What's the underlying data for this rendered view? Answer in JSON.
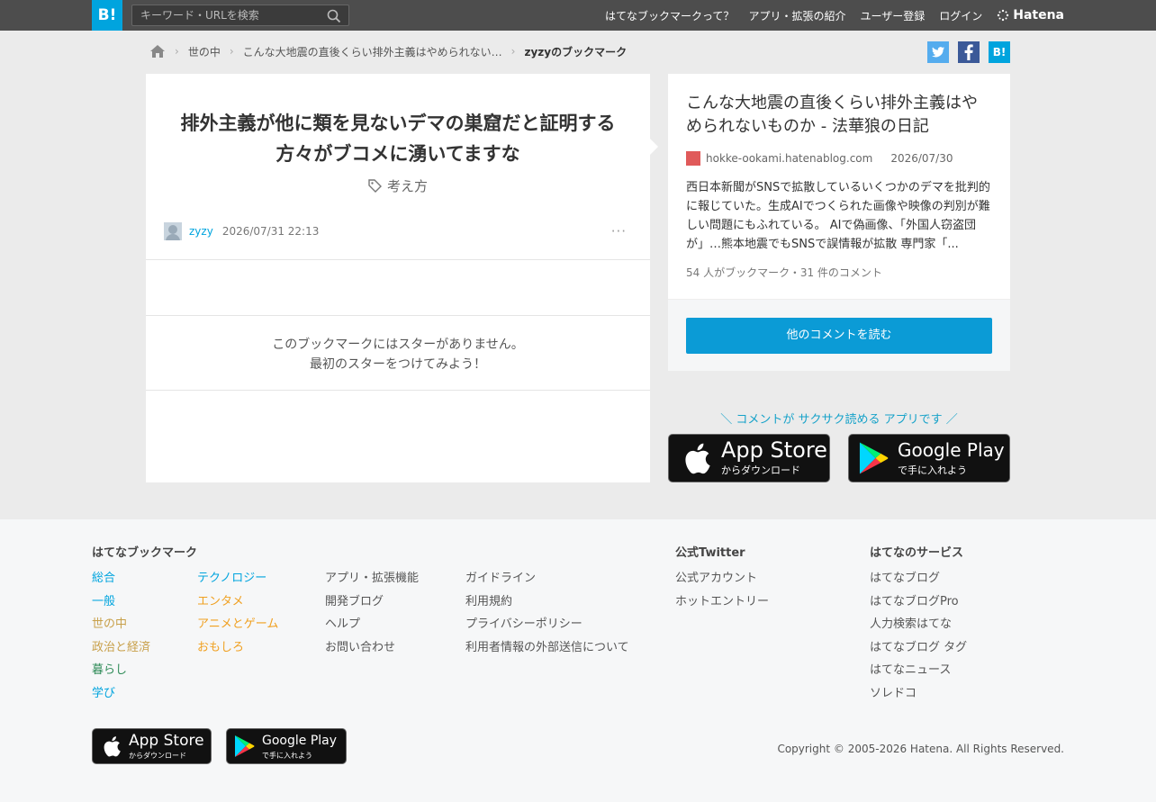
{
  "header": {
    "logo": "B!",
    "search_placeholder": "キーワード・URLを検索",
    "nav": [
      "はてなブックマークって？",
      "アプリ・拡張の紹介",
      "ユーザー登録",
      "ログイン"
    ],
    "hatena": "Hatena"
  },
  "breadcrumb": {
    "items": [
      "世の中",
      "こんな大地震の直後くらい排外主義はやめられない…"
    ],
    "current": "zyzyのブックマーク"
  },
  "share": {
    "hatena": "B!"
  },
  "bookmark": {
    "comment": "排外主義が他に類を見ないデマの巣窟だと証明する方々がブコメに湧いてますな",
    "tag": "考え方",
    "user": "zyzy",
    "date": "2026/07/31 22:13",
    "more": "···",
    "no_star_line1": "このブックマークにはスターがありません。",
    "no_star_line2": "最初のスターをつけてみよう！"
  },
  "entry": {
    "title": "こんな大地震の直後くらい排外主義はやめられないものか - 法華狼の日記",
    "domain": "hokke-ookami.hatenablog.com",
    "date": "2026/07/30",
    "description": "西日本新聞がSNSで拡散しているいくつかのデマを批判的に報じていた。生成AIでつくられた画像や映像の判別が難しい問題にもふれている。 AIで偽画像、「外国人窃盗団が」…熊本地震でもSNSで誤情報が拡散 専門家「...",
    "count": "54 人がブックマーク・31 件のコメント",
    "read_button": "他のコメントを読む"
  },
  "app_promo": {
    "text": "＼ コメントが サクサク読める アプリです ／",
    "app_store": "App Store",
    "app_store_sub": "からダウンロード",
    "google_play": "Google Play",
    "google_play_sub": "で手に入れよう"
  },
  "footer": {
    "bookmark_heading": "はてなブックマーク",
    "col1": [
      "総合",
      "一般",
      "世の中",
      "政治と経済",
      "暮らし",
      "学び"
    ],
    "col2": [
      "テクノロジー",
      "エンタメ",
      "アニメとゲーム",
      "おもしろ"
    ],
    "col3": [
      "アプリ・拡張機能",
      "開発ブログ",
      "ヘルプ",
      "お問い合わせ"
    ],
    "col4": [
      "ガイドライン",
      "利用規約",
      "プライバシーポリシー",
      "利用者情報の外部送信について"
    ],
    "twitter_heading": "公式Twitter",
    "twitter": [
      "公式アカウント",
      "ホットエントリー"
    ],
    "services_heading": "はてなのサービス",
    "services": [
      "はてなブログ",
      "はてなブログPro",
      "人力検索はてな",
      "はてなブログ タグ",
      "はてなニュース",
      "ソレドコ"
    ],
    "copyright": "Copyright © 2005-2026 Hatena. All Rights Reserved."
  },
  "colors": {
    "accent": "#00a4de",
    "col1": [
      "#00a4de",
      "#00a4de",
      "#c8a04a",
      "#c8a04a",
      "#2e8b57",
      "#00a4de"
    ],
    "col2": [
      "#00a4de",
      "#f0a020",
      "#f0a020",
      "#f0a020"
    ]
  }
}
